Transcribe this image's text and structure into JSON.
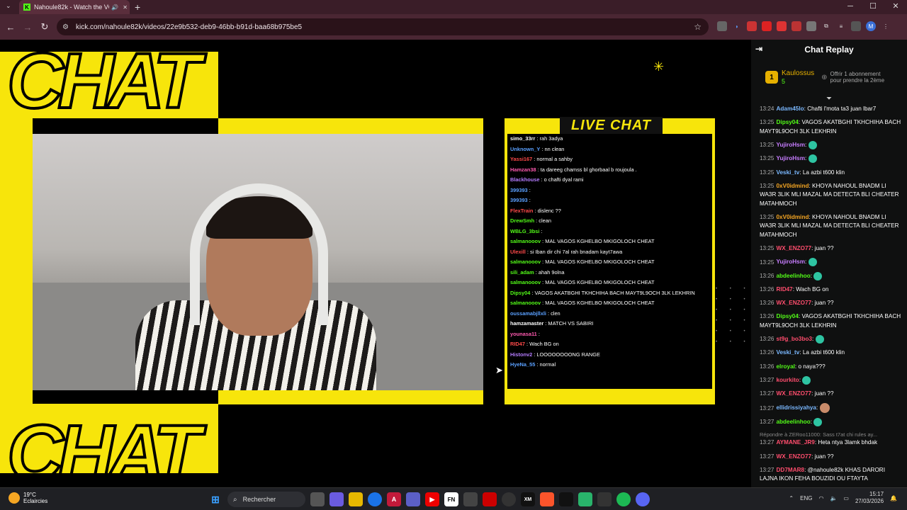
{
  "browser": {
    "tab_title": "Nahoule82k - Watch the VO",
    "url": "kick.com/nahoule82k/videos/22e9b532-deb9-46bb-b91d-baa68b975be5"
  },
  "stream_overlay": {
    "live_chat_title": "LIVE CHAT",
    "overlay_messages": [
      {
        "user": "simo_33rr",
        "text": "rah 3adya",
        "color": "#ffffff"
      },
      {
        "user": "Unknown_Y",
        "text": "nn clean",
        "color": "#5aa0ff"
      },
      {
        "user": "Yassi167",
        "text": "normal a sahby",
        "color": "#ff4a4a"
      },
      {
        "user": "Hamzan38",
        "text": "ta dareeg chamss bl ghorbaal b roujoula .",
        "color": "#ff5ab0"
      },
      {
        "user": "Blackhouse",
        "text": "o chafti dyal rami",
        "color": "#b57cff"
      },
      {
        "user": "399393",
        "text": "",
        "color": "#5aa0ff"
      },
      {
        "user": "399393",
        "text": "",
        "color": "#5aa0ff"
      },
      {
        "user": "FlexTrain",
        "text": "dislenc ??",
        "color": "#ff4a4a"
      },
      {
        "user": "DrewSmh",
        "text": "clean",
        "color": "#53fc18"
      },
      {
        "user": "WBLG_3bsi",
        "text": "",
        "color": "#53fc18"
      },
      {
        "user": "salmanooov",
        "text": "MAL VAGOS KGHELBO MKIGOLOCH CHEAT",
        "color": "#53fc18"
      },
      {
        "user": "Ulexill",
        "text": "si Iban dir chi 7al rah bnadam kayt7awa",
        "color": "#ff4a4a"
      },
      {
        "user": "salmanooov",
        "text": "MAL VAGOS KGHELBO MKIGOLOCH CHEAT",
        "color": "#53fc18"
      },
      {
        "user": "sili_adam",
        "text": "ahah 9olna",
        "color": "#53fc18"
      },
      {
        "user": "salmanooov",
        "text": "MAL VAGOS KGHELBO MKIGOLOCH CHEAT",
        "color": "#53fc18"
      },
      {
        "user": "Dipsy04",
        "text": "VAGOS AKATBGHI TKHCHIHA BACH MAYT9L9OCH 3LK LEKHRIN",
        "color": "#53fc18"
      },
      {
        "user": "salmanooov",
        "text": "MAL VAGOS KGHELBO MKIGOLOCH CHEAT",
        "color": "#53fc18"
      },
      {
        "user": "oussamabjllxli",
        "text": "clen",
        "color": "#5aa0ff"
      },
      {
        "user": "hamzamaster",
        "text": "MATCH VS SABIRI",
        "color": "#ffffff"
      },
      {
        "user": "younasa11",
        "text": "",
        "color": "#ff5ab0"
      },
      {
        "user": "RID47",
        "text": "Wach BG on",
        "color": "#ff4a4a"
      },
      {
        "user": "Histonv2",
        "text": "LOOOOOOOONG RANGE",
        "color": "#b57cff"
      },
      {
        "user": "HyeNa_55",
        "text": "normal",
        "color": "#5aa0ff"
      }
    ]
  },
  "chat_replay": {
    "title": "Chat Replay",
    "pinned": {
      "rank": "1",
      "name": "Kaulossus",
      "count": "5",
      "gift_line1": "Offrir 1 abonnement",
      "gift_line2": "pour prendre la 2ème"
    },
    "messages": [
      {
        "time": "13:24",
        "user": "Adam45lo",
        "text": "Chafti l'mota ta3 juan lbar7",
        "color": "#7ab8ff"
      },
      {
        "time": "13:25",
        "user": "Dipsy04",
        "text": "VAGOS AKATBGHI TKHCHIHA BACH MAYT9L9OCH 3LK LEKHRIN",
        "color": "#53fc18"
      },
      {
        "time": "13:25",
        "user": "YujiroHsm",
        "text": "",
        "color": "#c77dff",
        "emote": true
      },
      {
        "time": "13:25",
        "user": "YujiroHsm",
        "text": "",
        "color": "#c77dff",
        "emote": true
      },
      {
        "time": "13:25",
        "user": "Veski_tv",
        "text": "La azbi t600 klin",
        "color": "#7ab8ff"
      },
      {
        "time": "13:25",
        "user": "0xV0idmind",
        "text": "KHOYA NAHOUL BNADM LI WA3R 3LIK MLI MAZAL MA DETECTA BLI CHEATER MATAHMOCH",
        "color": "#f5a623"
      },
      {
        "time": "13:25",
        "user": "0xV0idmind",
        "text": "KHOYA NAHOUL BNADM LI WA3R 3LIK MLI MAZAL MA DETECTA BLI CHEATER MATAHMOCH",
        "color": "#f5a623"
      },
      {
        "time": "13:25",
        "user": "WX_ENZO77",
        "text": "juan ??",
        "color": "#ff4d6d"
      },
      {
        "time": "13:25",
        "user": "YujiroHsm",
        "text": "",
        "color": "#c77dff",
        "emote": true
      },
      {
        "time": "13:26",
        "user": "abdeelinhoo",
        "text": "",
        "color": "#53fc18",
        "emote": true
      },
      {
        "time": "13:26",
        "user": "RID47",
        "text": "Wach BG on",
        "color": "#ff4d6d"
      },
      {
        "time": "13:26",
        "user": "WX_ENZO77",
        "text": "juan ??",
        "color": "#ff4d6d"
      },
      {
        "time": "13:26",
        "user": "Dipsy04",
        "text": "VAGOS AKATBGHI TKHCHIHA BACH MAYT9L9OCH 3LK LEKHRIN",
        "color": "#53fc18"
      },
      {
        "time": "13:26",
        "user": "st9g_bo3bo3",
        "text": "",
        "color": "#ff4d6d",
        "emote": true
      },
      {
        "time": "13:26",
        "user": "Veski_tv",
        "text": "La azbi t600 klin",
        "color": "#7ab8ff"
      },
      {
        "time": "13:26",
        "user": "elroyal",
        "text": "o naya???",
        "color": "#53fc18"
      },
      {
        "time": "13:27",
        "user": "kourkito",
        "text": "",
        "color": "#ff4d6d",
        "emote": true
      },
      {
        "time": "13:27",
        "user": "WX_ENZO77",
        "text": "juan ??",
        "color": "#ff4d6d"
      },
      {
        "time": "13:27",
        "user": "ellidrissiyahya",
        "text": "",
        "color": "#7ab8ff",
        "avatar": true
      },
      {
        "time": "13:27",
        "user": "abdeelinhoo",
        "text": "",
        "color": "#53fc18",
        "emote": true
      },
      {
        "time": "13:27",
        "user": "AYMANE_JR9",
        "text": "Heta ntya 3lamk bhdak",
        "color": "#ff4d6d",
        "reply": "Répondre à ZERoo11000: Sass t7at chi rules ay..."
      },
      {
        "time": "13:27",
        "user": "WX_ENZO77",
        "text": "juan ??",
        "color": "#ff4d6d"
      },
      {
        "time": "13:27",
        "user": "DD7MAR8",
        "text": "@nahoule82k KHAS DARORI LAJNA IKON FEHA BOUZIDI OU FTAYTA",
        "color": "#ff4d6d"
      }
    ]
  },
  "taskbar": {
    "temp": "19°C",
    "weather": "Eclaircies",
    "search_label": "Rechercher",
    "lang": "ENG",
    "time": "15:17",
    "date": "27/03/2026"
  }
}
